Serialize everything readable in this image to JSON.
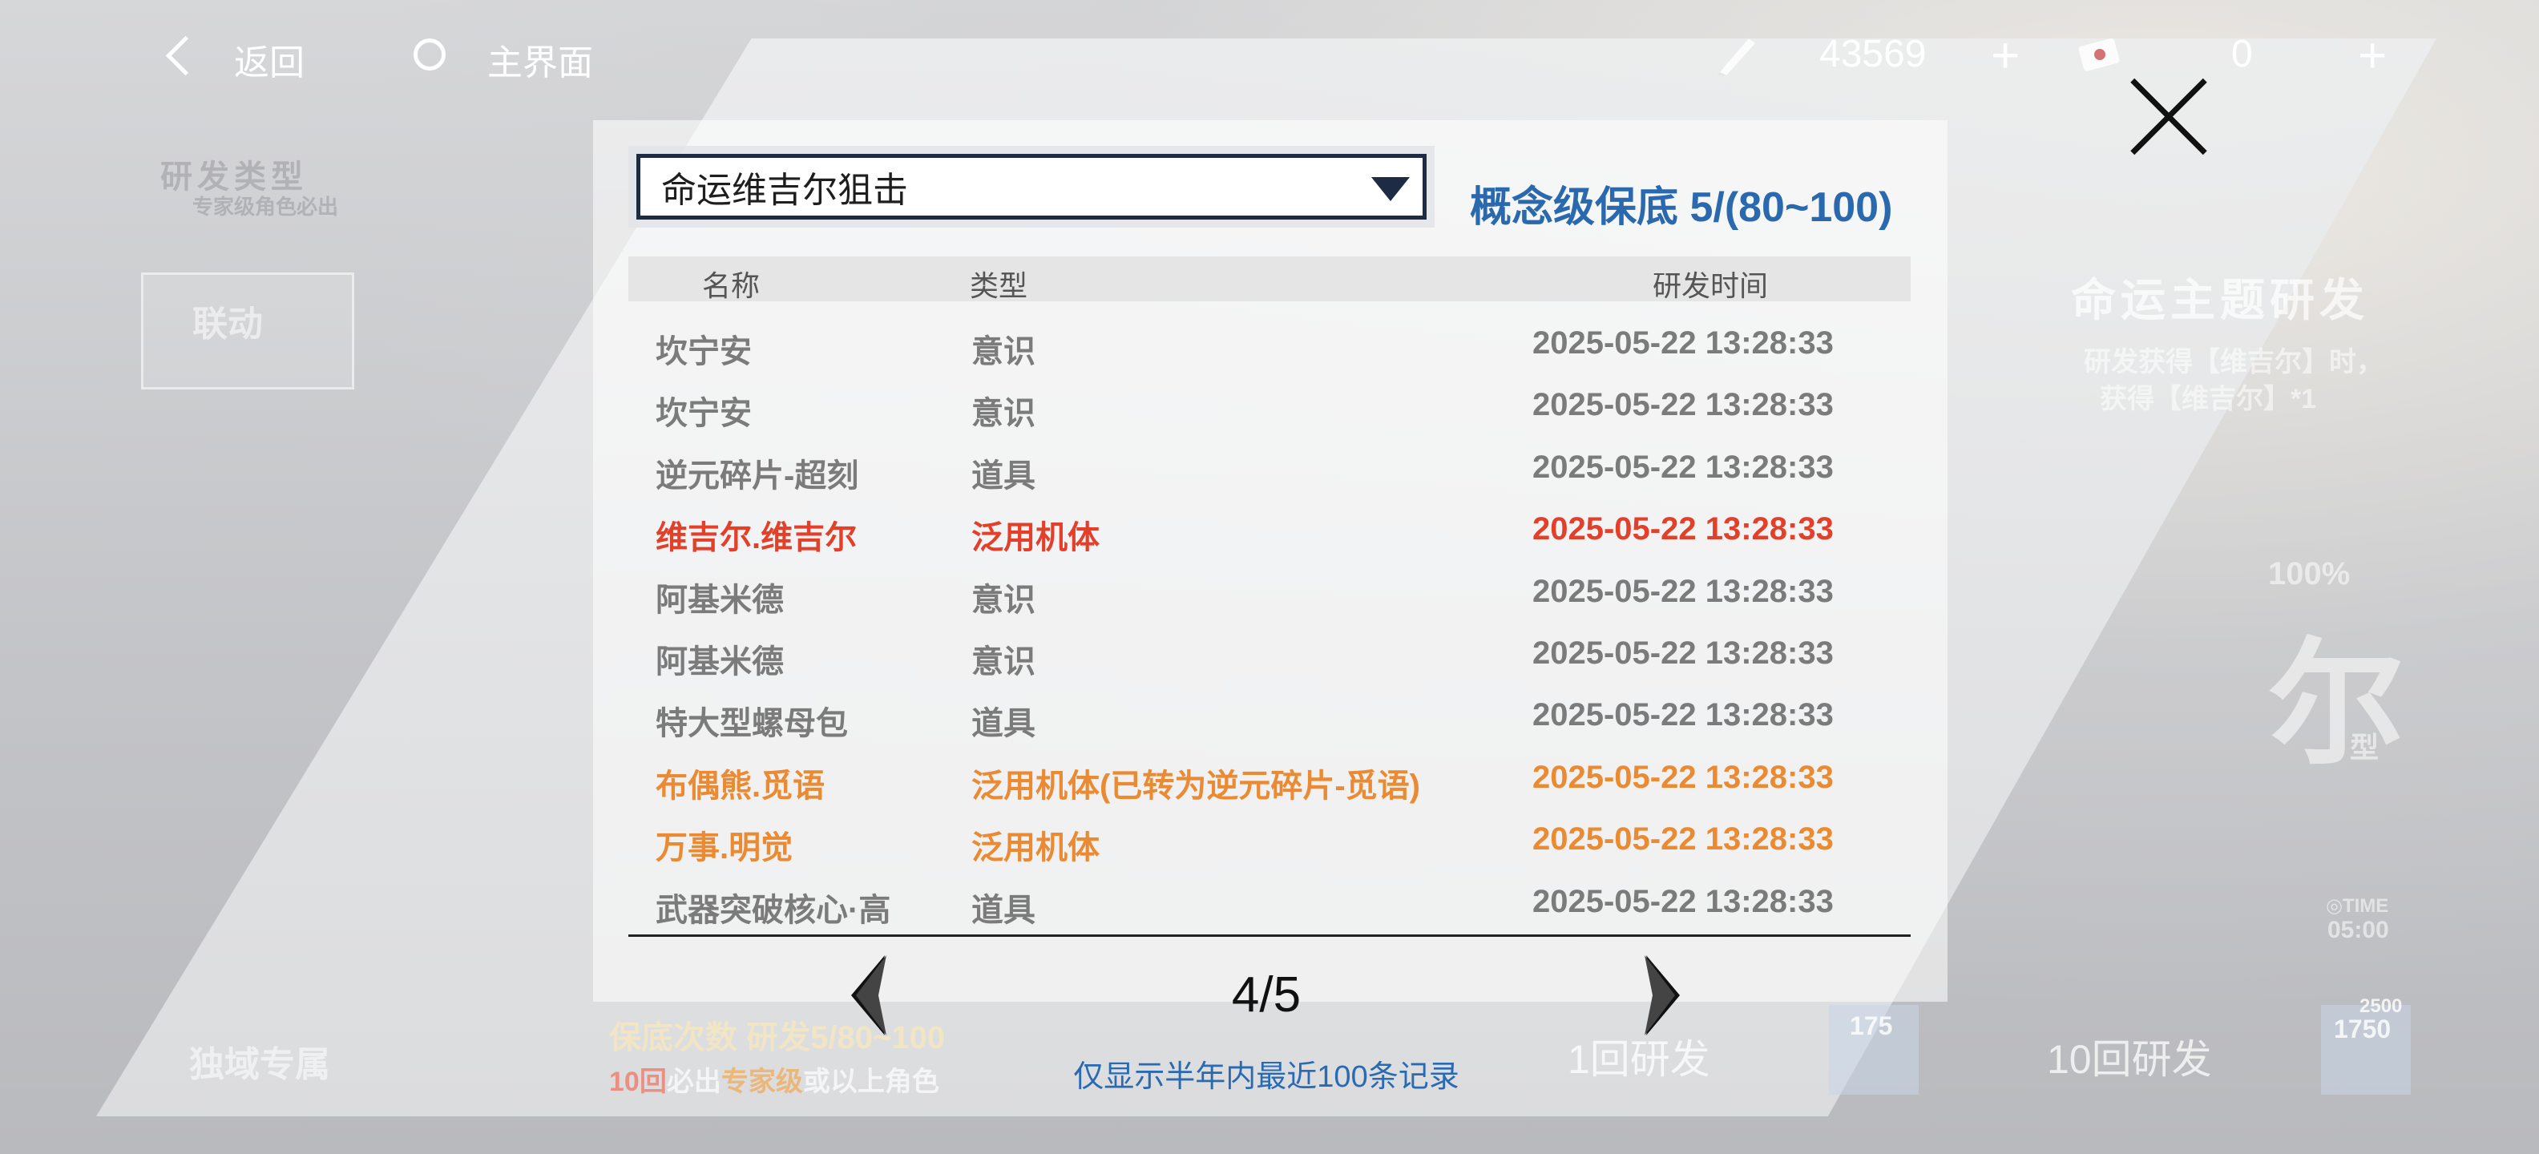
{
  "topbar": {
    "back_label": "返回",
    "home_label": "主界面",
    "currency1_value": "43569",
    "currency2_value": "0",
    "plus": "+"
  },
  "background": {
    "section_title": "研发类型",
    "section_sub": "专家级角色必出",
    "tab_label": "联动",
    "theme_title": "命运主题研发",
    "theme_desc1": "研发获得【维吉尔】时，",
    "theme_desc2": "获得【维吉尔】*1",
    "percent": "100%",
    "big_char": "尔",
    "type_char": "型",
    "time_label": "◎TIME",
    "time_value": "05:00",
    "bottom_left": "独域专属",
    "pity_line_bg": "保底次数  研发5/80~100",
    "guarantee_line_prefix": "10回",
    "guarantee_line_mid": "必出",
    "guarantee_line_hl": "专家级",
    "guarantee_line_suffix": "或以上角色",
    "btn1": "1回研发",
    "btn1_price": "175",
    "btn10": "10回研发",
    "btn10_price": "1750",
    "btn10_price_old": "2500"
  },
  "modal": {
    "selected_pool": "命运维吉尔狙击",
    "pity_text": "概念级保底 5/(80~100)",
    "columns": [
      "名称",
      "类型",
      "研发时间"
    ],
    "rows": [
      {
        "name": "坎宁安",
        "type": "意识",
        "time": "2025-05-22 13:28:33",
        "color": "#7b7b7b"
      },
      {
        "name": "坎宁安",
        "type": "意识",
        "time": "2025-05-22 13:28:33",
        "color": "#7b7b7b"
      },
      {
        "name": "逆元碎片-超刻",
        "type": "道具",
        "time": "2025-05-22 13:28:33",
        "color": "#7b7b7b"
      },
      {
        "name": "维吉尔.维吉尔",
        "type": "泛用机体",
        "time": "2025-05-22 13:28:33",
        "color": "#e2402a"
      },
      {
        "name": "阿基米德",
        "type": "意识",
        "time": "2025-05-22 13:28:33",
        "color": "#7b7b7b"
      },
      {
        "name": "阿基米德",
        "type": "意识",
        "time": "2025-05-22 13:28:33",
        "color": "#7b7b7b"
      },
      {
        "name": "特大型螺母包",
        "type": "道具",
        "time": "2025-05-22 13:28:33",
        "color": "#7b7b7b"
      },
      {
        "name": "布偶熊.觅语",
        "type": "泛用机体(已转为逆元碎片-觅语)",
        "time": "2025-05-22 13:28:33",
        "color": "#ea8a32"
      },
      {
        "name": "万事.明觉",
        "type": "泛用机体",
        "time": "2025-05-22 13:28:33",
        "color": "#ea8a32"
      },
      {
        "name": "武器突破核心·高",
        "type": "道具",
        "time": "2025-05-22 13:28:33",
        "color": "#7b7b7b"
      }
    ],
    "page": "4/5",
    "note": "仅显示半年内最近100条记录"
  }
}
